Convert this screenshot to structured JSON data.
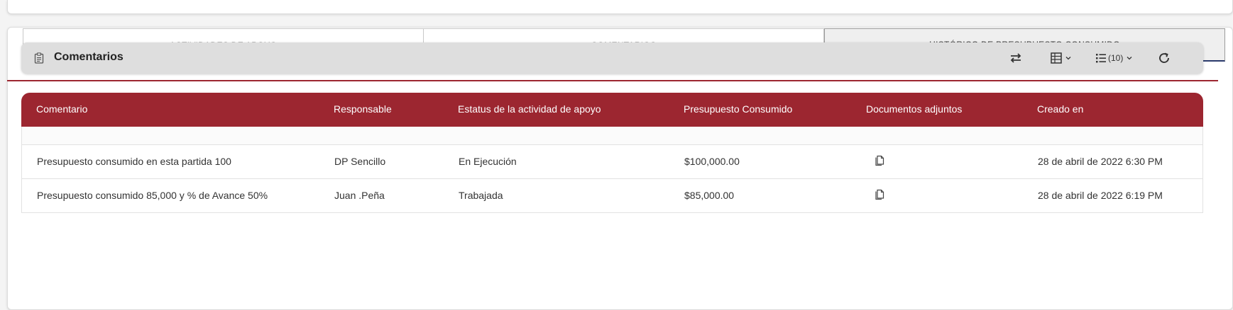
{
  "tabs": [
    {
      "label": "ACTIVIDADES DE APOYO",
      "active": false
    },
    {
      "label": "COMENTARIOS",
      "active": false
    },
    {
      "label": "HISTÓRICO DE PRESUPUESTO CONSUMIDO",
      "active": true
    }
  ],
  "panel": {
    "title": "Comentarios",
    "icon": "clipboard-icon",
    "page_size_label": "(10)"
  },
  "table": {
    "columns": [
      "Comentario",
      "Responsable",
      "Estatus de la actividad de apoyo",
      "Presupuesto Consumido",
      "Documentos adjuntos",
      "Creado en"
    ],
    "rows": [
      {
        "comentario": "Presupuesto consumido en esta partida 100",
        "responsable": "DP Sencillo",
        "estatus": "En Ejecución",
        "presupuesto": "$100,000.00",
        "documento_icon": "document-icon",
        "creado": "28 de abril de 2022 6:30 PM"
      },
      {
        "comentario": "Presupuesto consumido 85,000 y % de Avance 50%",
        "responsable": "Juan .Peña",
        "estatus": "Trabajada",
        "presupuesto": "$85,000.00",
        "documento_icon": "document-icon",
        "creado": "28 de abril de 2022 6:19 PM"
      }
    ]
  },
  "colors": {
    "header_red": "#9c2630",
    "active_tab_border": "#2a3a6b"
  }
}
